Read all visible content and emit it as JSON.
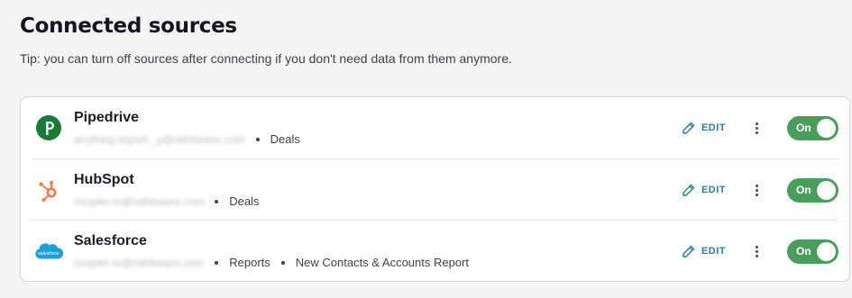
{
  "header": {
    "title": "Connected sources",
    "tip": "Tip: you can turn off sources after connecting if you don't need data from them anymore."
  },
  "colors": {
    "toggle_on": "#4a9d5c",
    "edit_link": "#2b7f9a",
    "pipedrive": "#1a7a3a",
    "hubspot": "#f57b4b",
    "salesforce": "#1ba0da"
  },
  "sources": [
    {
      "name": "Pipedrive",
      "icon": "pipedrive-logo",
      "account": "anything.import._y@rathbeans.com",
      "objects": [
        "Deals"
      ],
      "edit_label": "EDIT",
      "toggle_label": "On"
    },
    {
      "name": "HubSpot",
      "icon": "hubspot-logo",
      "account": "coupler-io@rathbeans.com",
      "objects": [
        "Deals"
      ],
      "edit_label": "EDIT",
      "toggle_label": "On"
    },
    {
      "name": "Salesforce",
      "icon": "salesforce-logo",
      "account": "coupler-io@rathbeans.com",
      "objects": [
        "Reports",
        "New Contacts & Accounts Report"
      ],
      "edit_label": "EDIT",
      "toggle_label": "On"
    }
  ]
}
